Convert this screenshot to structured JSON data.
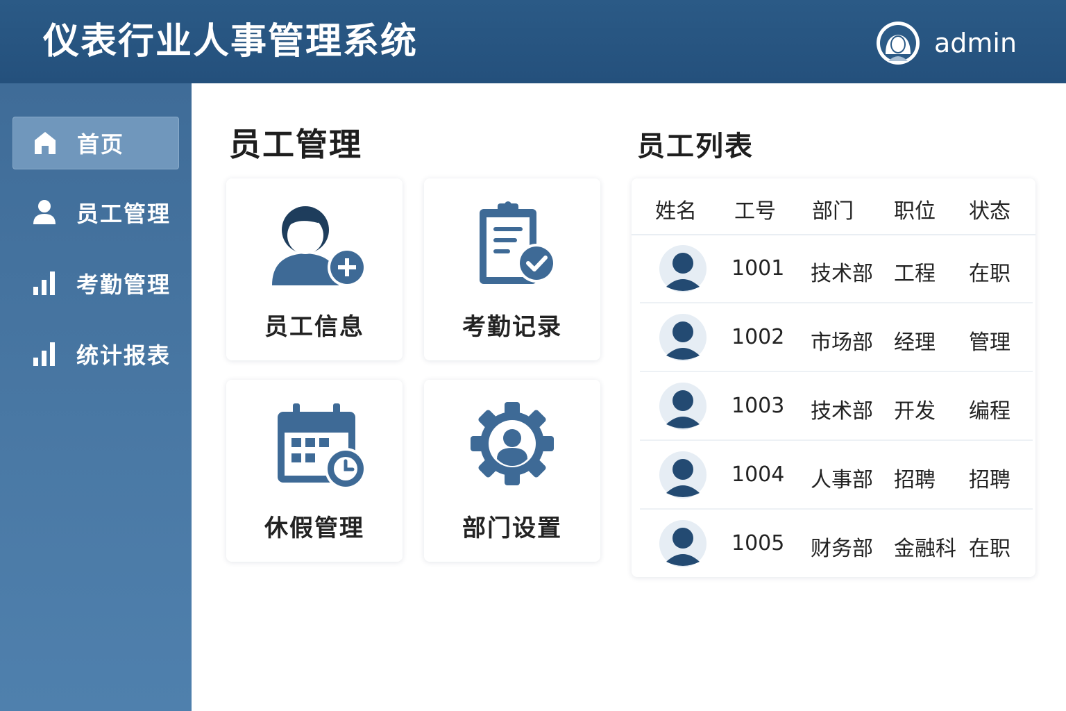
{
  "header": {
    "app_title": "仪表行业人事管理系统",
    "username": "admin"
  },
  "sidebar": {
    "items": [
      {
        "label": "首页",
        "icon": "home-icon",
        "active": true
      },
      {
        "label": "员工管理",
        "icon": "user-icon",
        "active": false
      },
      {
        "label": "考勤管理",
        "icon": "bar-chart-icon",
        "active": false
      },
      {
        "label": "统计报表",
        "icon": "bar-chart-icon",
        "active": false
      }
    ]
  },
  "main": {
    "section_title": "员工管理",
    "cards": [
      {
        "label": "员工信息",
        "icon": "add-user-icon"
      },
      {
        "label": "考勤记录",
        "icon": "clipboard-check-icon"
      },
      {
        "label": "休假管理",
        "icon": "calendar-clock-icon"
      },
      {
        "label": "部门设置",
        "icon": "gear-user-icon"
      }
    ]
  },
  "employee_list": {
    "title": "员工列表",
    "columns": [
      "姓名",
      "工号",
      "部门",
      "职位",
      "状态"
    ],
    "rows": [
      {
        "id": "1001",
        "dept": "技术部",
        "position": "工程",
        "status": "在职"
      },
      {
        "id": "1002",
        "dept": "市场部",
        "position": "经理",
        "status": "管理"
      },
      {
        "id": "1003",
        "dept": "技术部",
        "position": "开发",
        "status": "编程"
      },
      {
        "id": "1004",
        "dept": "人事部",
        "position": "招聘",
        "status": "招聘"
      },
      {
        "id": "1005",
        "dept": "财务部",
        "position": "金融科",
        "status": "在职"
      }
    ]
  },
  "colors": {
    "header_bg": "#24507c",
    "sidebar_bg": "#4a79a5",
    "icon_accent": "#3e6a96",
    "icon_dark": "#1e3d5c"
  }
}
